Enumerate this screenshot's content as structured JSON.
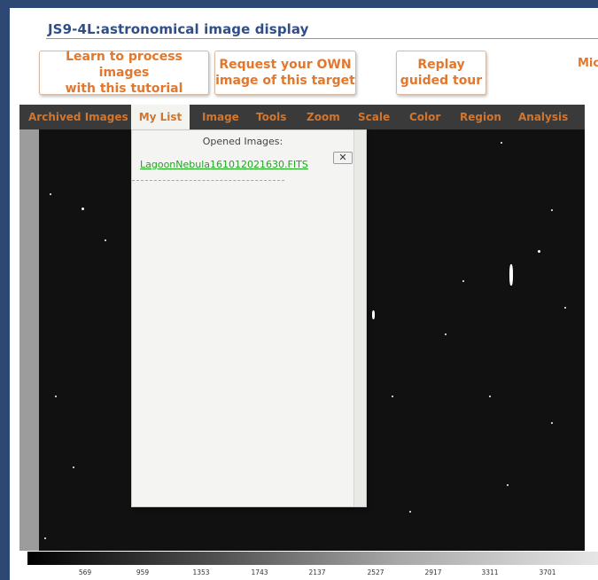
{
  "app": {
    "title": "JS9-4L:astronomical image display"
  },
  "actions": {
    "tutorial_label": "Learn to process images\nwith this tutorial",
    "request_label": "Request your OWN\nimage of this target",
    "replay_label": "Replay\nguided tour",
    "truncated_label": "Mic"
  },
  "menubar": {
    "items": [
      {
        "label": "Archived Images"
      },
      {
        "label": "My List"
      },
      {
        "label": "Image"
      },
      {
        "label": "Tools"
      },
      {
        "label": "Zoom"
      },
      {
        "label": "Scale"
      },
      {
        "label": "Color"
      },
      {
        "label": "Region"
      },
      {
        "label": "Analysis"
      }
    ],
    "active": "My List"
  },
  "mylist": {
    "heading": "Opened Images:",
    "close_label": "✕",
    "images": [
      "LagoonNebula161012021630.FITS"
    ]
  },
  "colorbar": {
    "ticks": [
      "569",
      "959",
      "1353",
      "1743",
      "2137",
      "2527",
      "2917",
      "3311",
      "3701"
    ]
  },
  "colors": {
    "accent": "#e2772d",
    "frame": "#2d4872",
    "title": "#2f4f86",
    "menubar_bg": "#3a3a3a",
    "link_green": "#1aa81a"
  }
}
